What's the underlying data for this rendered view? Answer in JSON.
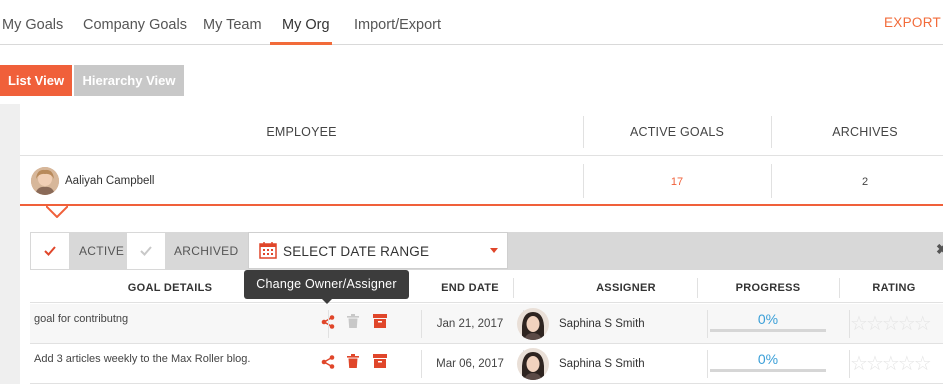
{
  "nav": {
    "tabs": [
      {
        "label": "My Goals"
      },
      {
        "label": "Company Goals"
      },
      {
        "label": "My Team"
      },
      {
        "label": "My Org"
      },
      {
        "label": "Import/Export"
      }
    ],
    "active_tab": "My Org",
    "export_label": "EXPORT G"
  },
  "views": {
    "list_label": "List View",
    "hierarchy_label": "Hierarchy View"
  },
  "employee_table": {
    "headers": {
      "employee": "EMPLOYEE",
      "active_goals": "ACTIVE GOALS",
      "archives": "ARCHIVES"
    },
    "row": {
      "name": "Aaliyah Campbell",
      "active_goals": "17",
      "archives": "2"
    }
  },
  "filters": {
    "active_label": "ACTIVE",
    "archived_label": "ARCHIVED",
    "date_range_label": "SELECT DATE RANGE"
  },
  "goals_table": {
    "headers": {
      "goal_details": "GOAL DETAILS",
      "end_date": "END DATE",
      "assigner": "ASSIGNER",
      "progress": "PROGRESS",
      "rating": "RATING"
    },
    "rows": [
      {
        "goal": "goal for contributng",
        "end_date": "Jan 21, 2017",
        "assigner": "Saphina S Smith",
        "progress": "0%"
      },
      {
        "goal": "Add 3 articles weekly to the Max Roller blog.",
        "end_date": "Mar 06, 2017",
        "assigner": "Saphina S Smith",
        "progress": "0%"
      }
    ]
  },
  "tooltip": {
    "text": "Change Owner/Assigner"
  },
  "colors": {
    "accent": "#f0603a",
    "progress": "#3a9fd8",
    "inactive_button": "#c8c8c8"
  }
}
